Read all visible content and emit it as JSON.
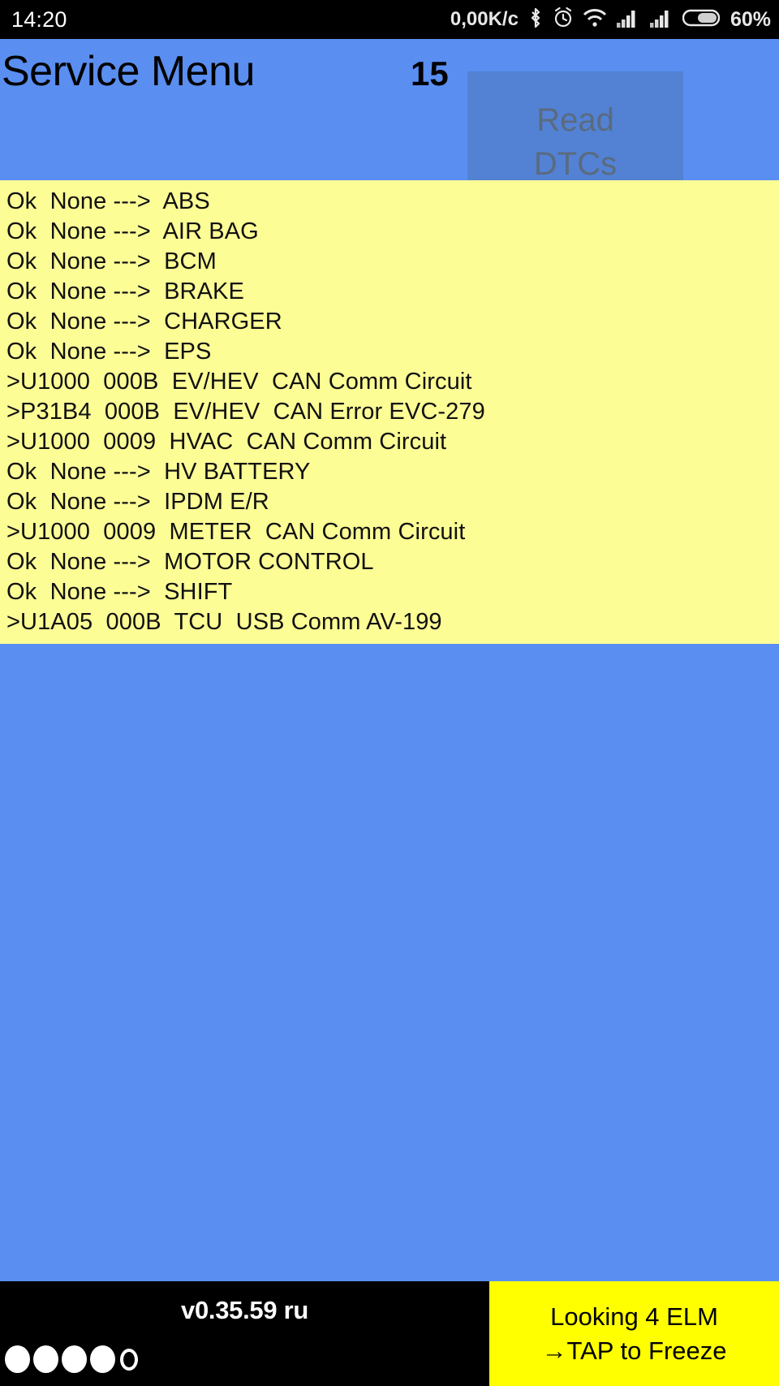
{
  "status_bar": {
    "clock": "14:20",
    "net_speed": "0,00K/c",
    "battery_percent": "60%",
    "icons": [
      "bluetooth-icon",
      "alarm-icon",
      "wifi-icon",
      "signal-sim1-icon",
      "signal-sim2-icon",
      "battery-icon"
    ]
  },
  "header": {
    "title": "Service Menu",
    "count": "15",
    "read_dtcs_line1": "Read",
    "read_dtcs_line2": "DTCs",
    "background_color": "#5a8ef0",
    "button_disabled": true
  },
  "dtc_list": {
    "background_color": "#fdfd96",
    "rows": [
      {
        "text": "Ok  None --->  ABS",
        "status": "ok",
        "module": "ABS"
      },
      {
        "text": "Ok  None --->  AIR BAG",
        "status": "ok",
        "module": "AIR BAG"
      },
      {
        "text": "Ok  None --->  BCM",
        "status": "ok",
        "module": "BCM"
      },
      {
        "text": "Ok  None --->  BRAKE",
        "status": "ok",
        "module": "BRAKE"
      },
      {
        "text": "Ok  None --->  CHARGER",
        "status": "ok",
        "module": "CHARGER"
      },
      {
        "text": "Ok  None --->  EPS",
        "status": "ok",
        "module": "EPS"
      },
      {
        "text": ">U1000  000B  EV/HEV  CAN Comm Circuit",
        "status": "error",
        "module": "EV/HEV"
      },
      {
        "text": ">P31B4  000B  EV/HEV  CAN Error EVC-279",
        "status": "error",
        "module": "EV/HEV"
      },
      {
        "text": ">U1000  0009  HVAC  CAN Comm Circuit",
        "status": "error",
        "module": "HVAC"
      },
      {
        "text": "Ok  None --->  HV BATTERY",
        "status": "ok",
        "module": "HV BATTERY"
      },
      {
        "text": "Ok  None --->  IPDM E/R",
        "status": "ok",
        "module": "IPDM E/R"
      },
      {
        "text": ">U1000  0009  METER  CAN Comm Circuit",
        "status": "error",
        "module": "METER"
      },
      {
        "text": "Ok  None --->  MOTOR CONTROL",
        "status": "ok",
        "module": "MOTOR CONTROL"
      },
      {
        "text": "Ok  None --->  SHIFT",
        "status": "ok",
        "module": "SHIFT"
      },
      {
        "text": ">U1A05  000B  TCU  USB Comm AV-199",
        "status": "error",
        "module": "TCU"
      }
    ]
  },
  "bottom_bar": {
    "version": "v0.35.59 ru",
    "dots_filled": 4,
    "dots_hollow": 1,
    "elm_line1": "Looking 4 ELM",
    "elm_line2": "→TAP to Freeze",
    "elm_background_color": "#ffff00"
  }
}
